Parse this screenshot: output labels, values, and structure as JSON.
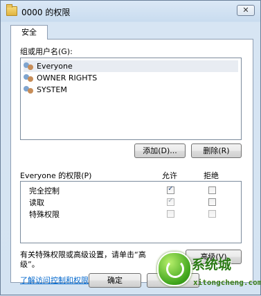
{
  "window": {
    "title": "0000 的权限",
    "close_glyph": "✕"
  },
  "tabs": [
    {
      "label": "安全"
    }
  ],
  "groups": {
    "label": "组或用户名(G):",
    "items": [
      {
        "name": "Everyone",
        "selected": true
      },
      {
        "name": "OWNER RIGHTS",
        "selected": false
      },
      {
        "name": "SYSTEM",
        "selected": false
      }
    ],
    "add_label": "添加(D)...",
    "remove_label": "删除(R)"
  },
  "permissions": {
    "header": "Everyone 的权限(P)",
    "allow_header": "允许",
    "deny_header": "拒绝",
    "rows": [
      {
        "name": "完全控制",
        "allow": true,
        "allow_enabled": true,
        "deny": false,
        "deny_enabled": true
      },
      {
        "name": "读取",
        "allow": true,
        "allow_enabled": false,
        "deny": false,
        "deny_enabled": true
      },
      {
        "name": "特殊权限",
        "allow": false,
        "allow_enabled": false,
        "deny": false,
        "deny_enabled": false
      }
    ]
  },
  "advanced": {
    "text_line1": "有关特殊权限或高级设置，请单击“高",
    "text_line2": "级”。",
    "button_label": "高级(V)"
  },
  "help_link": "了解访问控制和权限",
  "footer": {
    "ok_label": "确定",
    "cancel_label": "取消"
  },
  "watermark": {
    "text": "系统城",
    "url": "xitongcheng.com"
  },
  "icons": {
    "folder": "folder-icon",
    "users": "users-icon",
    "check": "✓"
  },
  "colors": {
    "link": "#0066cc",
    "watermark_green": "#3fa51c"
  }
}
